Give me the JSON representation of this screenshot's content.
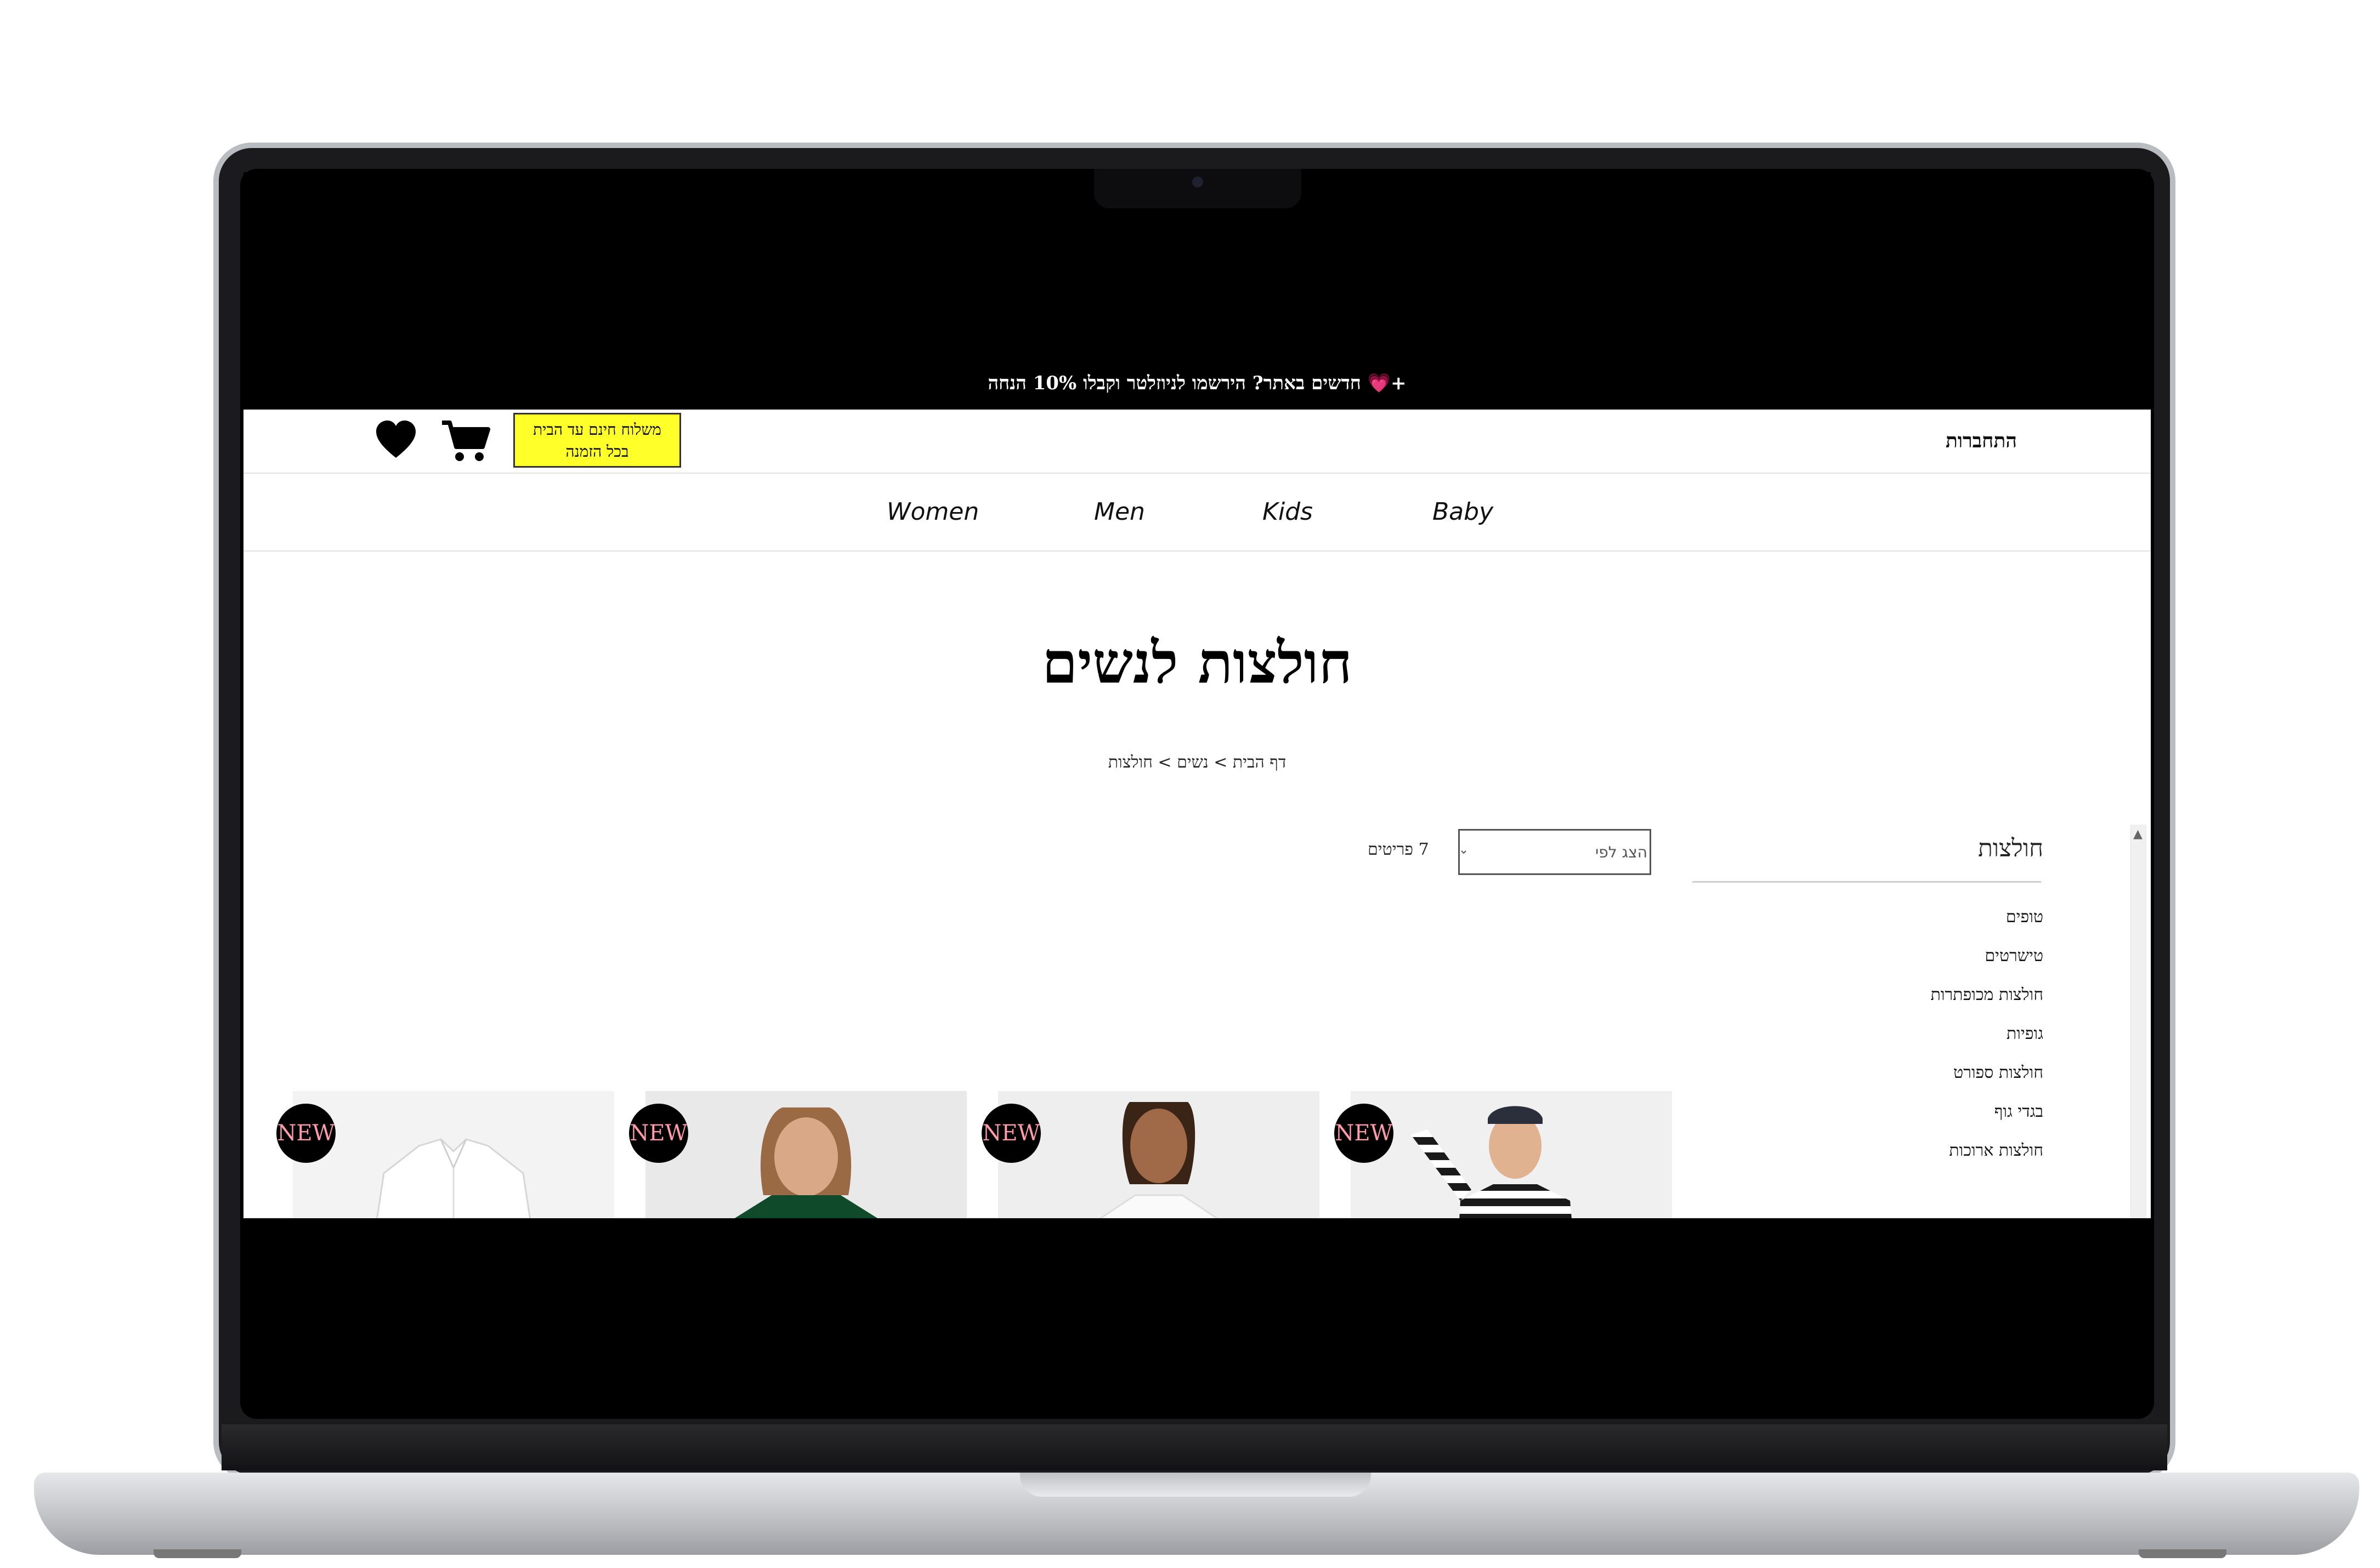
{
  "promo": {
    "text": "חדשים באתר? הירשמו לניוזלטר וקבלו 10% הנחה",
    "plus": "+",
    "heart": "💗"
  },
  "header": {
    "login": "התחברות",
    "free_shipping_line1": "משלוח חינם עד הבית",
    "free_shipping_line2": "בכל הזמנה"
  },
  "nav": [
    "Women",
    "Men",
    "Kids",
    "Baby"
  ],
  "page": {
    "title": "חולצות לנשים",
    "breadcrumb": "דף הבית > נשים > חולצות"
  },
  "toolbar": {
    "results_count": "7",
    "results_label": "פריטים",
    "sort_placeholder": "הצג לפי"
  },
  "sidebar": {
    "title": "חולצות",
    "items": [
      "טופים",
      "טישרטים",
      "חולצות מכופתרות",
      "גופיות",
      "חולצות ספורט",
      "בגדי גוף",
      "חולצות ארוכות"
    ]
  },
  "products": [
    {
      "badge": "NEW"
    },
    {
      "badge": "NEW"
    },
    {
      "badge": "NEW"
    },
    {
      "badge": "NEW"
    }
  ],
  "colors": {
    "promo_bg": "#000000",
    "free_ship_bg": "#ffff2a",
    "badge_text": "#ff9aa8"
  }
}
